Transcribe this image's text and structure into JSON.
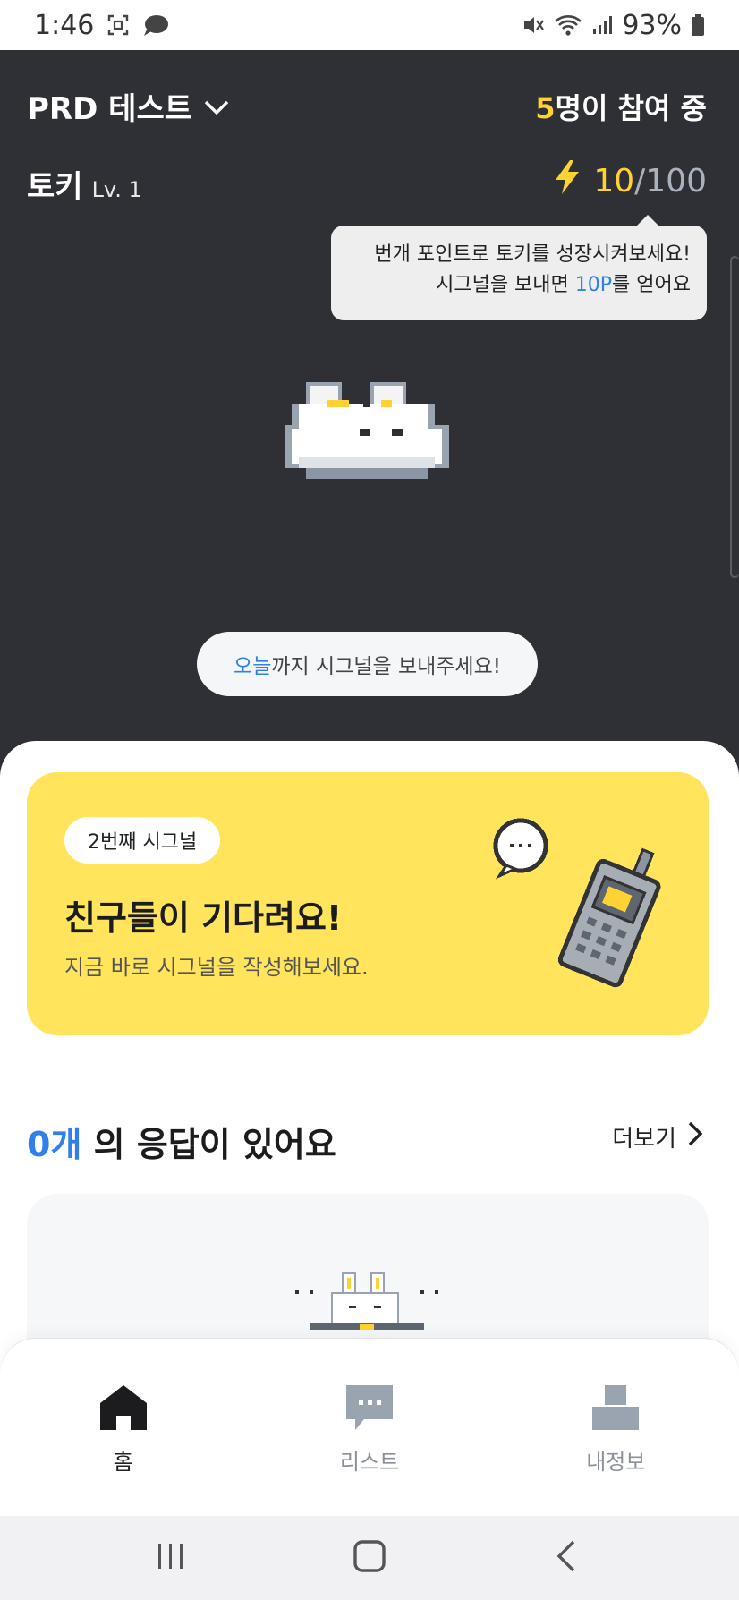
{
  "status_bar": {
    "time": "1:46",
    "battery": "93%"
  },
  "hero": {
    "group_title": "PRD 테스트",
    "participants_count": "5",
    "participants_suffix": "명이 참여 중",
    "character_name": "토키",
    "character_level": "Lv. 1",
    "points_current": "10",
    "points_separator": "/",
    "points_max": "100",
    "tooltip_line1": "번개 포인트로 토키를 성장시켜보세요!",
    "tooltip_line2_pre": "시그널을 보내면 ",
    "tooltip_line2_hl": "10P",
    "tooltip_line2_post": "를 얻어요",
    "deadline_hl": "오늘",
    "deadline_text": "까지 시그널을 보내주세요!"
  },
  "signal_card": {
    "badge": "2번째 시그널",
    "headline": "친구들이 기다려요!",
    "subtitle": "지금 바로 시그널을 작성해보세요."
  },
  "responses": {
    "count": "0개",
    "title_suffix": " 의 응답이 있어요",
    "more_label": "더보기"
  },
  "bottom_nav": {
    "items": [
      {
        "label": "홈",
        "icon": "home-icon",
        "active": true
      },
      {
        "label": "리스트",
        "icon": "chat-list-icon",
        "active": false
      },
      {
        "label": "내정보",
        "icon": "profile-icon",
        "active": false
      }
    ]
  },
  "colors": {
    "hero_bg": "#2e3035",
    "accent_yellow": "#ffd233",
    "card_yellow": "#ffe45c",
    "accent_blue": "#2f80ed"
  }
}
